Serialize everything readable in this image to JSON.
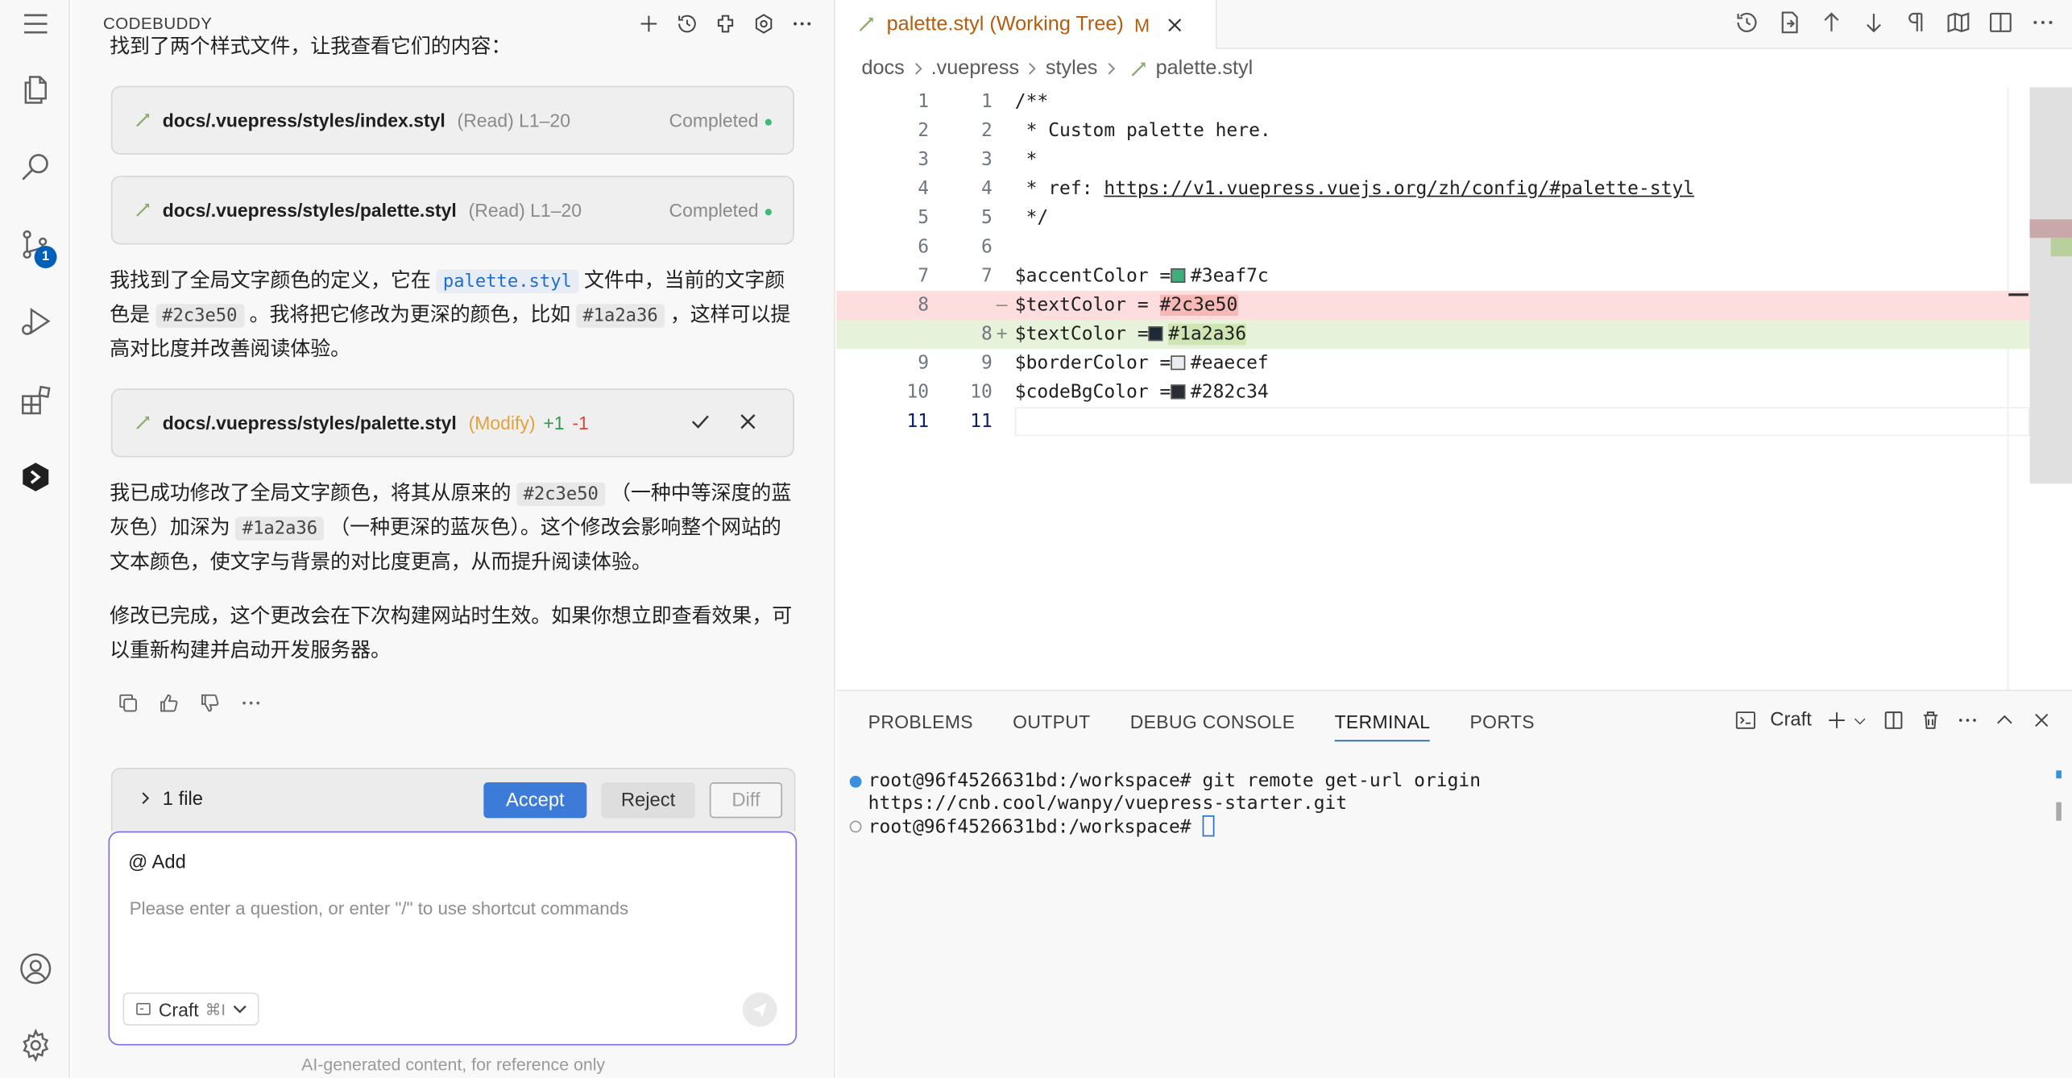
{
  "activity_bar": {
    "items": [
      "menu-icon",
      "files-icon",
      "search-icon",
      "source-control-icon",
      "run-debug-icon",
      "extensions-icon",
      "codebuddy-icon"
    ],
    "source_control_badge": "1",
    "bottom": [
      "account-icon",
      "settings-gear-icon"
    ]
  },
  "codebuddy": {
    "title": "CODEBUDDY",
    "cropped_intro": "找到了两个样式文件，让我查看它们的内容：",
    "cards": [
      {
        "path": "docs/.vuepress/styles/index.styl",
        "meta": "(Read) L1–20",
        "status": "Completed"
      },
      {
        "path": "docs/.vuepress/styles/palette.styl",
        "meta": "(Read) L1–20",
        "status": "Completed"
      }
    ],
    "para1": {
      "p1": "我找到了全局文字颜色的定义，它在",
      "c1": "palette.styl",
      "p2": "文件中，当前的文字颜色是",
      "c2": "#2c3e50",
      "p3": "。我将把它修改为更深的颜色，比如",
      "c3": "#1a2a36",
      "p4": "，这样可以提高对比度并改善阅读体验。"
    },
    "modify_card": {
      "path": "docs/.vuepress/styles/palette.styl",
      "action": "(Modify)",
      "plus": "+1",
      "minus": "-1"
    },
    "para2": {
      "p1": "我已成功修改了全局文字颜色，将其从原来的",
      "c1": "#2c3e50",
      "p2": "（一种中等深度的蓝灰色）加深为",
      "c2": "#1a2a36",
      "p3": "（一种更深的蓝灰色）。这个修改会影响整个网站的文本颜色，使文字与背景的对比度更高，从而提升阅读体验。"
    },
    "para3": "修改已完成，这个更改会在下次构建网站时生效。如果你想立即查看效果，可以重新构建并启动开发服务器。",
    "changes": {
      "label": "1 file",
      "accept": "Accept",
      "reject": "Reject",
      "diff": "Diff"
    },
    "input": {
      "add_label": "Add",
      "placeholder": "Please enter a question, or enter \"/\" to use shortcut commands",
      "mode": "Craft",
      "shortcut": "⌘I"
    },
    "disclaimer": "AI-generated content, for reference only"
  },
  "editor": {
    "tab": {
      "label": "palette.styl (Working Tree)",
      "badge": "M"
    },
    "breadcrumb": [
      "docs",
      ".vuepress",
      "styles",
      "palette.styl"
    ],
    "lines": [
      {
        "a": "1",
        "b": "1",
        "text": "/**"
      },
      {
        "a": "2",
        "b": "2",
        "text": " * Custom palette here."
      },
      {
        "a": "3",
        "b": "3",
        "text": " *"
      },
      {
        "a": "4",
        "b": "4",
        "pre": " * ref: ",
        "link": "https://v1.vuepress.vuejs.org/zh/config/#palette-styl"
      },
      {
        "a": "5",
        "b": "5",
        "text": " */"
      },
      {
        "a": "6",
        "b": "6",
        "text": ""
      },
      {
        "a": "7",
        "b": "7",
        "pre": "$accentColor =",
        "color": "#3eaf7c",
        "val": "#3eaf7c"
      },
      {
        "a": "8",
        "b": "",
        "gutter": "—",
        "pre": "$textColor = ",
        "hl": "#2c3e50"
      },
      {
        "a": "",
        "b": "8",
        "gutter": "+",
        "pre": "$textColor =",
        "color": "#1a2a36",
        "hl": "#1a2a36"
      },
      {
        "a": "9",
        "b": "9",
        "pre": "$borderColor =",
        "color": "#eaecef",
        "val": "#eaecef"
      },
      {
        "a": "10",
        "b": "10",
        "pre": "$codeBgColor =",
        "color": "#282c34",
        "val": "#282c34"
      },
      {
        "a": "11",
        "b": "11",
        "text": ""
      }
    ]
  },
  "panel": {
    "tabs": [
      "PROBLEMS",
      "OUTPUT",
      "DEBUG CONSOLE",
      "TERMINAL",
      "PORTS"
    ],
    "active_tab": "TERMINAL",
    "terminal_name": "Craft",
    "terminal_lines": [
      "root@96f4526631bd:/workspace# git remote get-url origin",
      "https://cnb.cool/wanpy/vuepress-starter.git",
      "root@96f4526631bd:/workspace# "
    ]
  }
}
